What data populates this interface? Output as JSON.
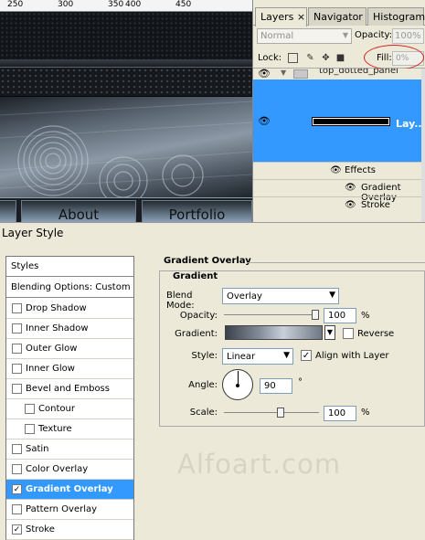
{
  "ruler": {
    "marks": [
      "250",
      "300",
      "350",
      "400",
      "450"
    ]
  },
  "canvas": {
    "nav_buttons": [
      "About",
      "Portfolio"
    ]
  },
  "layers_panel": {
    "tabs": [
      "Layers ×",
      "Navigator",
      "Histogram"
    ],
    "blend_mode": "Normal",
    "opacity_label": "Opacity:",
    "opacity_value": "100%",
    "lock_label": "Lock:",
    "fill_label": "Fill:",
    "fill_value": "0%",
    "layers": {
      "top_name": "top_dotted_panel",
      "selected_name": "Lay..."
    },
    "effects_label": "Effects",
    "effects": [
      "Gradient Overlay",
      "Stroke"
    ]
  },
  "dialog": {
    "title": "Layer Style",
    "styles_header": "Styles",
    "blending_options": "Blending Options: Custom",
    "style_items": [
      {
        "label": "Drop Shadow",
        "checked": false
      },
      {
        "label": "Inner Shadow",
        "checked": false
      },
      {
        "label": "Outer Glow",
        "checked": false
      },
      {
        "label": "Inner Glow",
        "checked": false
      },
      {
        "label": "Bevel and Emboss",
        "checked": false
      },
      {
        "label": "Contour",
        "checked": false
      },
      {
        "label": "Texture",
        "checked": false
      },
      {
        "label": "Satin",
        "checked": false
      },
      {
        "label": "Color Overlay",
        "checked": false
      },
      {
        "label": "Gradient Overlay",
        "checked": true
      },
      {
        "label": "Pattern Overlay",
        "checked": false
      },
      {
        "label": "Stroke",
        "checked": true
      }
    ],
    "section_title": "Gradient Overlay",
    "group_title": "Gradient",
    "blend_mode_label": "Blend Mode:",
    "blend_mode_value": "Overlay",
    "opacity_label": "Opacity:",
    "opacity_value": "100",
    "opacity_pct": 1.0,
    "percent": "%",
    "gradient_label": "Gradient:",
    "reverse_label": "Reverse",
    "reverse_checked": false,
    "style_label": "Style:",
    "style_value": "Linear",
    "align_label": "Align with Layer",
    "align_checked": true,
    "angle_label": "Angle:",
    "angle_value": "90",
    "degree": "°",
    "scale_label": "Scale:",
    "scale_value": "100",
    "scale_pct": 1.0
  },
  "watermark": "Alfoart.com",
  "colors": {
    "selection": "#3399ff",
    "panel_bg": "#ece9d8",
    "fill_highlight": "#d42020"
  }
}
